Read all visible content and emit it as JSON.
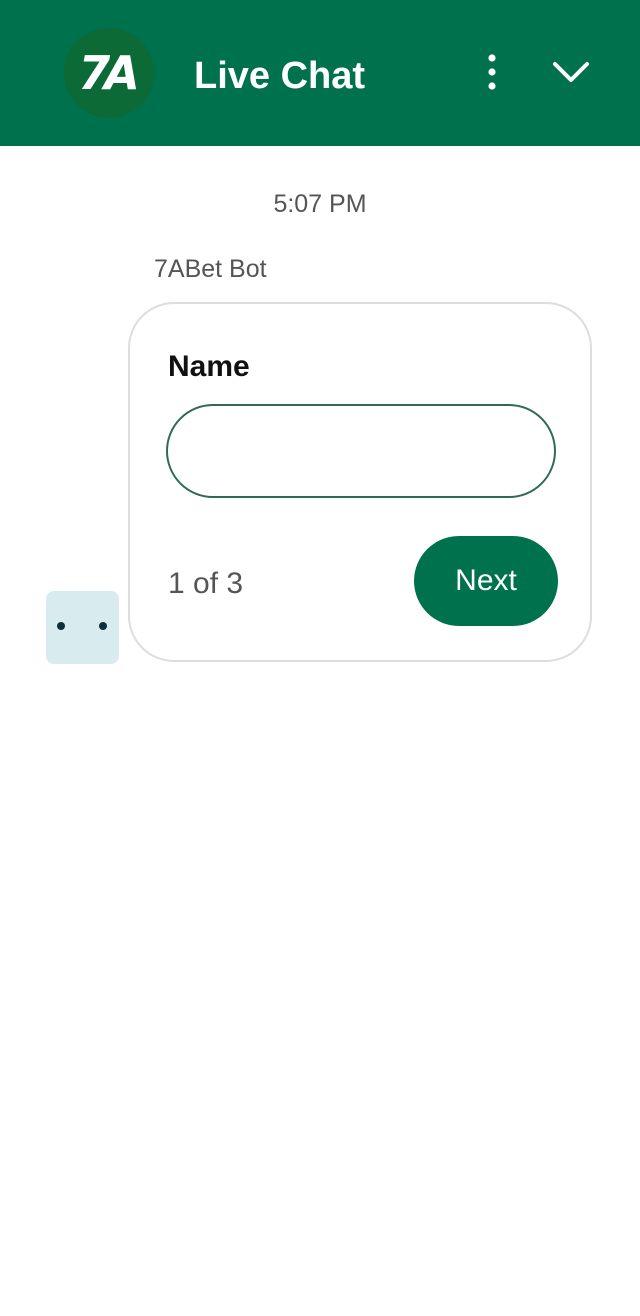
{
  "header": {
    "logo_text": "7A",
    "title": "Live Chat",
    "menu_icon": "more-vertical-icon",
    "collapse_icon": "chevron-down-icon",
    "background_color": "#00714d"
  },
  "conversation": {
    "timestamp": "5:07 PM",
    "sender_name": "7ABet Bot",
    "form_card": {
      "field_label": "Name",
      "field_value": "",
      "field_placeholder": "",
      "pager_text": "1 of 3",
      "next_label": "Next"
    },
    "bot_avatar_icon": "bot-face-icon"
  },
  "colors": {
    "brand_green": "#00714d",
    "input_border": "#2e6b57",
    "avatar_bg": "#d8ecef"
  }
}
